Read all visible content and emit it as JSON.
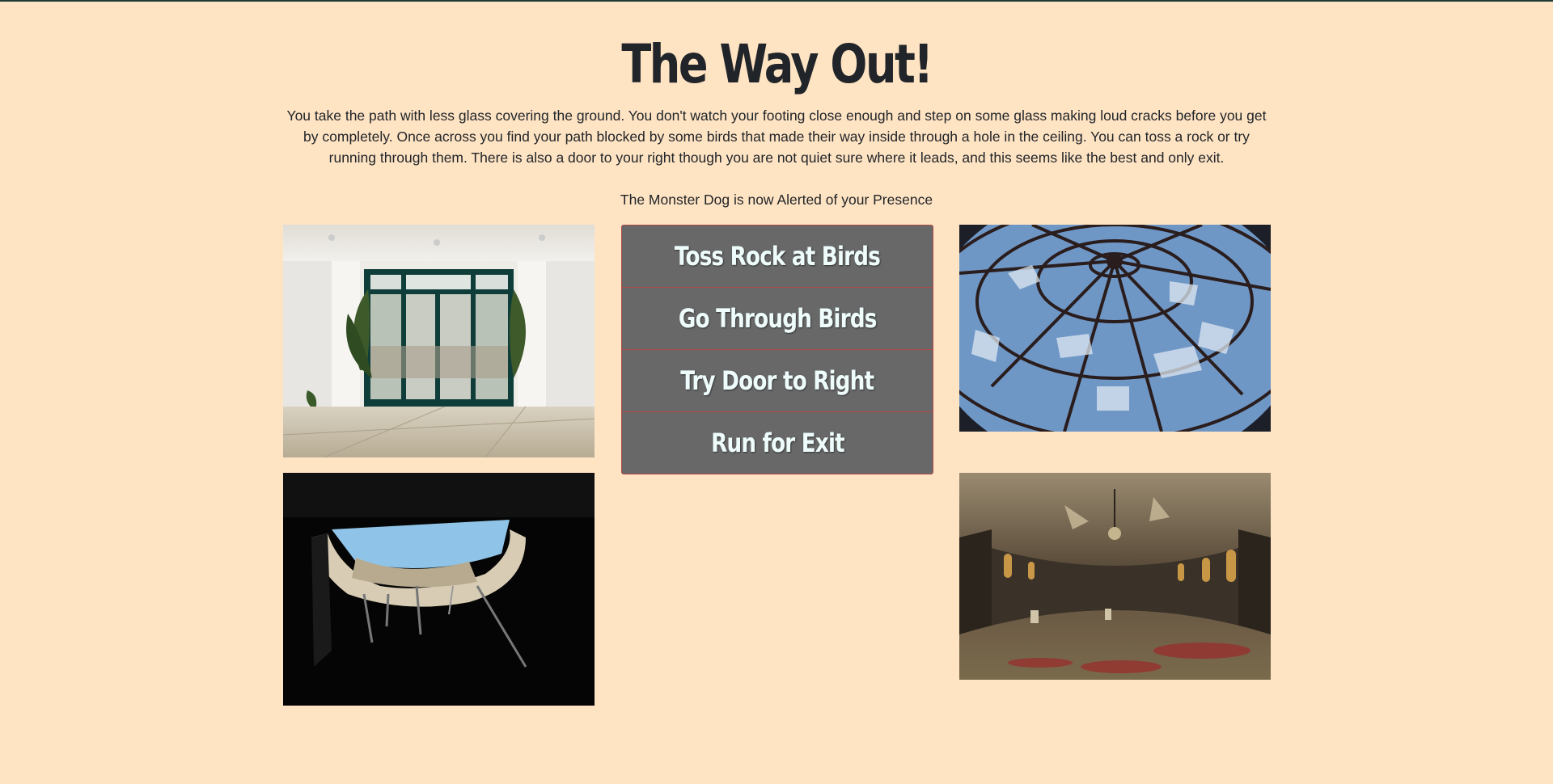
{
  "page": {
    "title": "The Way Out!",
    "story": "You take the path with less glass covering the ground. You don't watch your footing close enough and step on some glass making loud cracks before you get by completely. Once across you find your path blocked by some birds that made their way inside through a hole in the ceiling. You can toss a rock or try running through them. There is also a door to your right though you are not quiet sure where it leads, and this seems like the best and only exit.",
    "alert": "The Monster Dog is now Alerted of your Presence"
  },
  "choices": [
    {
      "label": "Toss Rock at Birds"
    },
    {
      "label": "Go Through Birds"
    },
    {
      "label": "Try Door to Right"
    },
    {
      "label": "Run for Exit"
    }
  ],
  "images": [
    {
      "name": "abandoned-glass-doors-photo"
    },
    {
      "name": "ceiling-hole-photo"
    },
    {
      "name": "broken-glass-dome-photo"
    },
    {
      "name": "abandoned-ballroom-photo"
    }
  ],
  "colors": {
    "background": "#ffe4c4",
    "button_bg": "#686868",
    "button_border": "#b04848",
    "button_text": "#eefcfc",
    "text": "#212529"
  }
}
